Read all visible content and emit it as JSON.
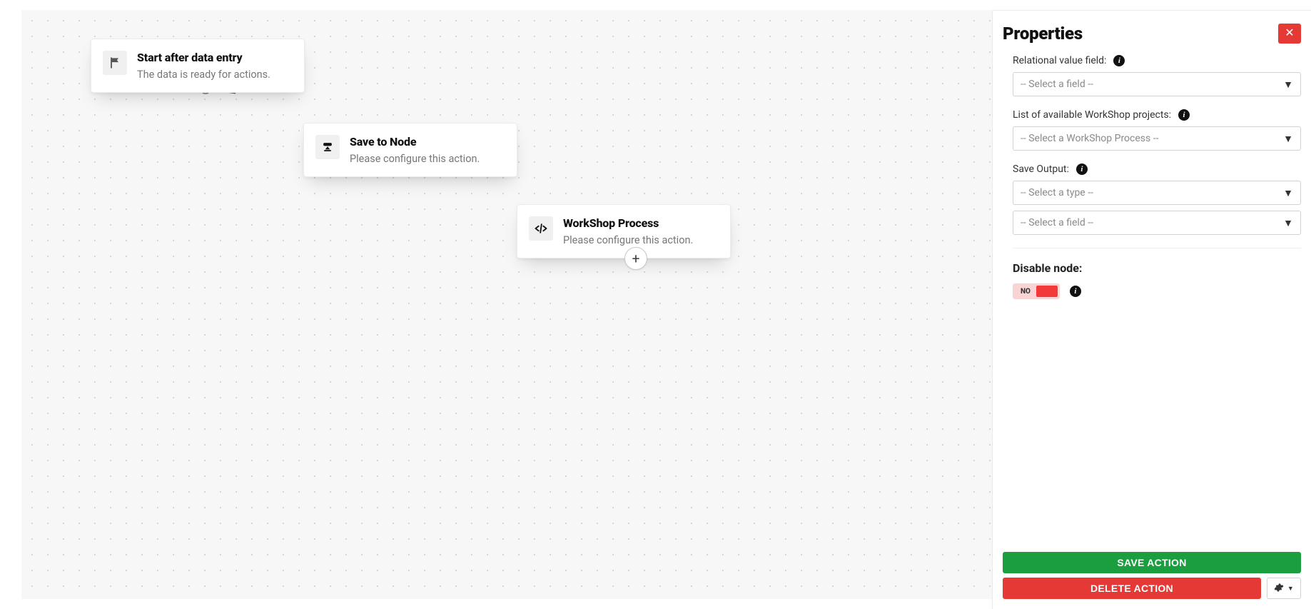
{
  "panel": {
    "title": "Properties",
    "fields": {
      "relational_label": "Relational value field:",
      "relational_placeholder": "-- Select a field --",
      "projects_label": "List of available WorkShop projects:",
      "projects_placeholder": "-- Select a WorkShop Process --",
      "save_output_label": "Save Output:",
      "type_placeholder": "-- Select a type --",
      "field_placeholder": "-- Select a field --",
      "disable_label": "Disable node:",
      "toggle_text": "NO"
    },
    "buttons": {
      "save": "SAVE ACTION",
      "delete": "DELETE ACTION"
    }
  },
  "nodes": {
    "n1": {
      "title": "Start after data entry",
      "subtitle": "The data is ready for actions."
    },
    "n2": {
      "title": "Save to Node",
      "subtitle": "Please configure this action."
    },
    "n3": {
      "title": "WorkShop Process",
      "subtitle": "Please configure this action."
    }
  }
}
